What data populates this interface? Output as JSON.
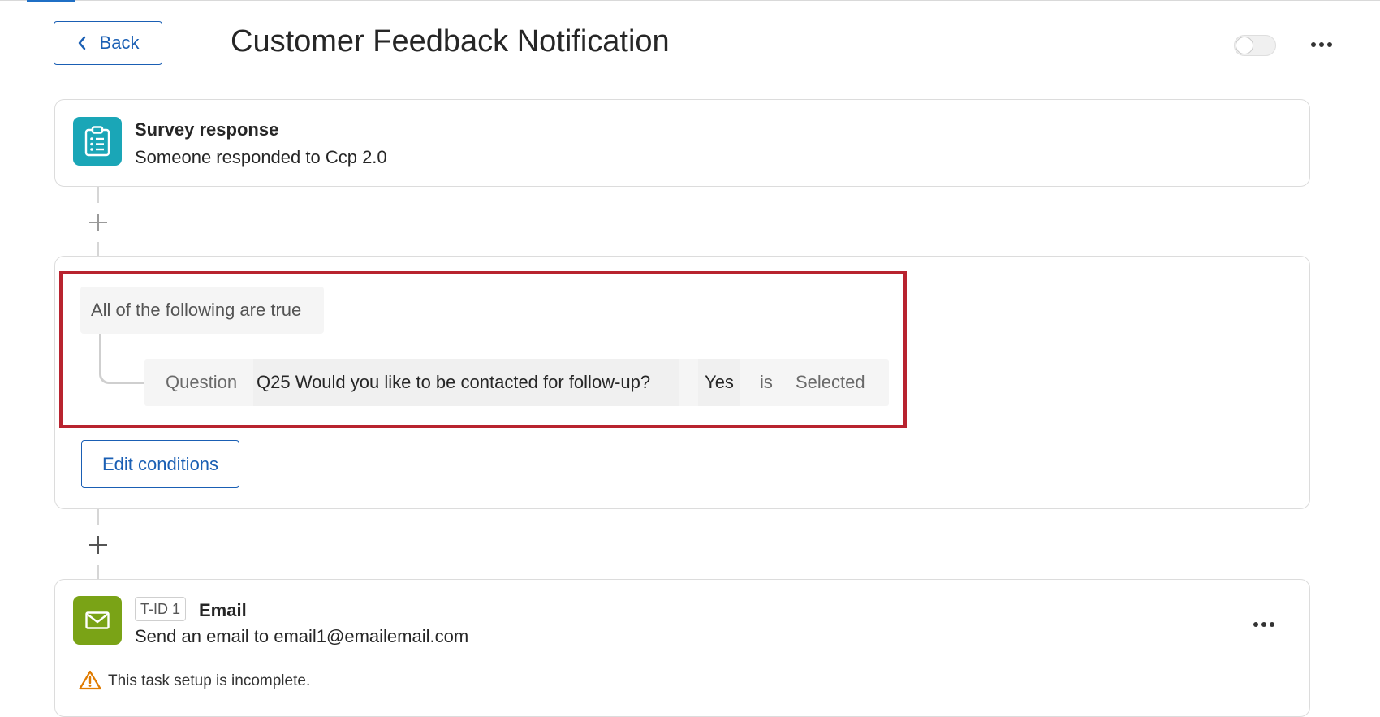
{
  "header": {
    "back_label": "Back",
    "title": "Customer Feedback Notification"
  },
  "trigger": {
    "icon": "clipboard-list-icon",
    "title": "Survey response",
    "subtitle": "Someone responded to Ccp 2.0"
  },
  "conditions": {
    "group_label": "All of the following are true",
    "rows": [
      {
        "type": "Question",
        "question": "Q25 Would you like to be contacted for follow-up?",
        "choice": "Yes",
        "operator": "is",
        "value": "Selected"
      }
    ],
    "edit_label": "Edit conditions"
  },
  "task": {
    "icon": "envelope-icon",
    "id_badge": "T-ID 1",
    "title": "Email",
    "subtitle": "Send an email to email1@emailemail.com",
    "warning": "This task setup is incomplete."
  },
  "colors": {
    "accent": "#1a5fb4",
    "survey_tile": "#1aa6b7",
    "email_tile": "#7aa316",
    "highlight": "#b8232f",
    "warning": "#e07b00"
  }
}
